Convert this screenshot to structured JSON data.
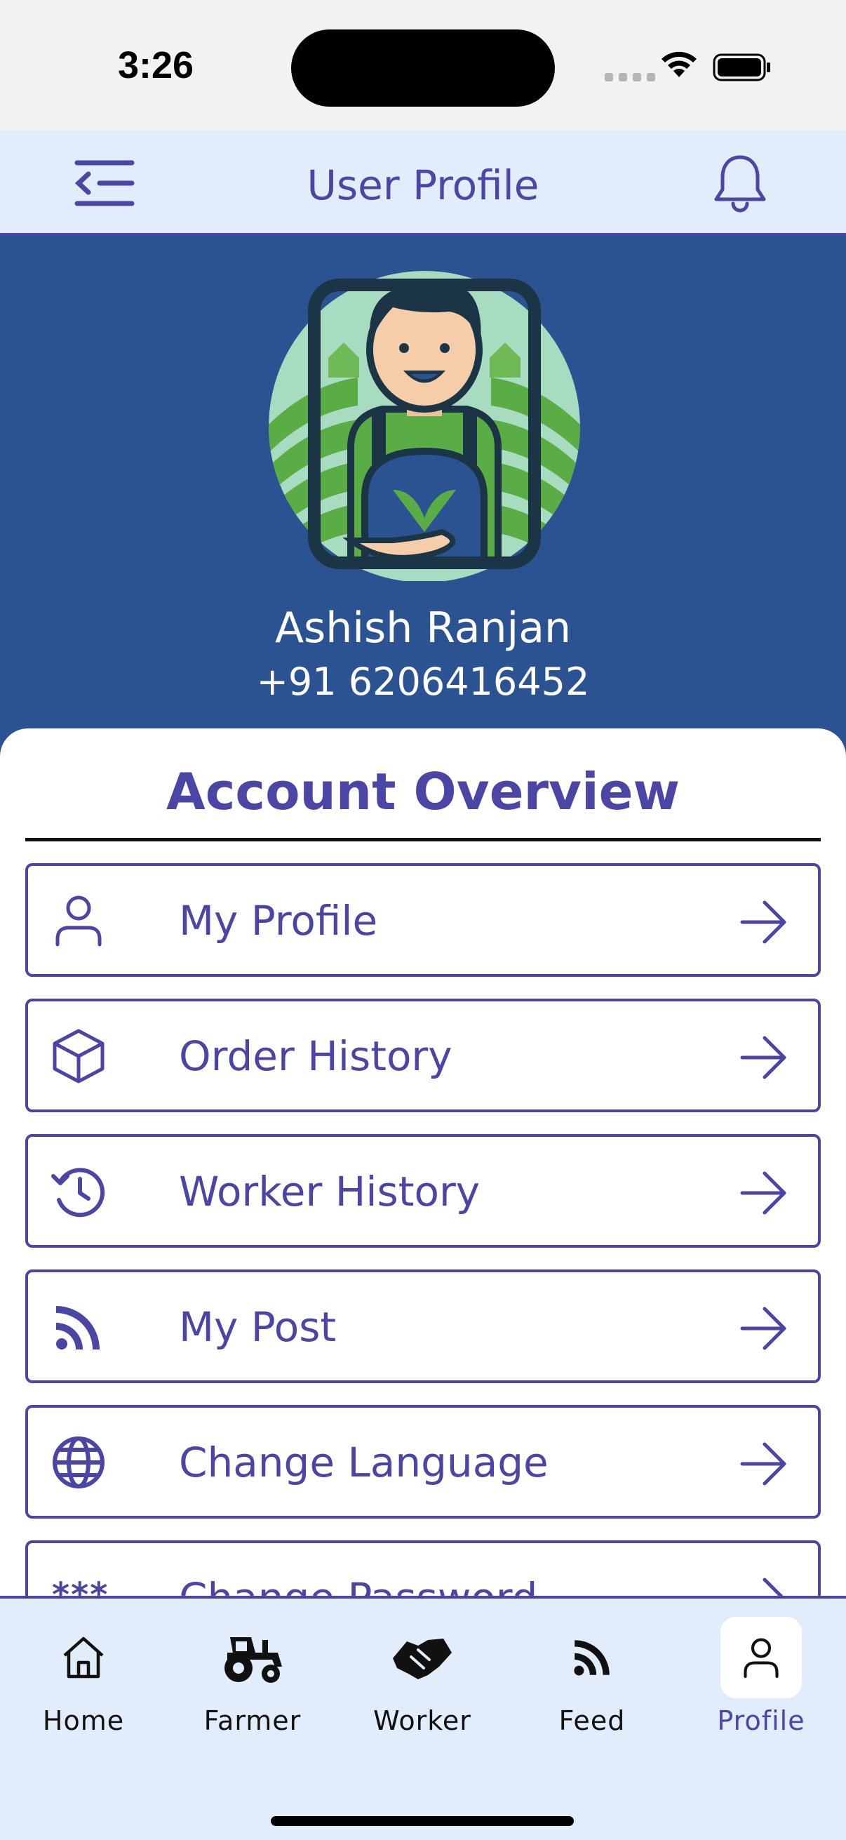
{
  "status_bar": {
    "time": "3:26"
  },
  "header": {
    "title": "User Profile",
    "menu_icon": "menu-collapse-icon",
    "bell_icon": "bell-icon"
  },
  "profile": {
    "name": "Ashish Ranjan",
    "phone": "+91 6206416452"
  },
  "overview": {
    "title": "Account Overview",
    "items": [
      {
        "label": "My Profile",
        "icon": "user-icon"
      },
      {
        "label": "Order History",
        "icon": "box-icon"
      },
      {
        "label": "Worker History",
        "icon": "history-icon"
      },
      {
        "label": "My Post",
        "icon": "rss-icon"
      },
      {
        "label": "Change Language",
        "icon": "globe-icon"
      },
      {
        "label": "Change Password",
        "icon": "asterisk-icon"
      }
    ]
  },
  "bottom_nav": {
    "active": "Profile",
    "items": [
      {
        "label": "Home",
        "icon": "home-icon"
      },
      {
        "label": "Farmer",
        "icon": "tractor-icon"
      },
      {
        "label": "Worker",
        "icon": "handshake-icon"
      },
      {
        "label": "Feed",
        "icon": "rss-icon"
      },
      {
        "label": "Profile",
        "icon": "user-icon"
      }
    ]
  },
  "colors": {
    "accent": "#4b45a5",
    "hero_bg": "#2c5391",
    "header_bg": "#e1edfb"
  }
}
